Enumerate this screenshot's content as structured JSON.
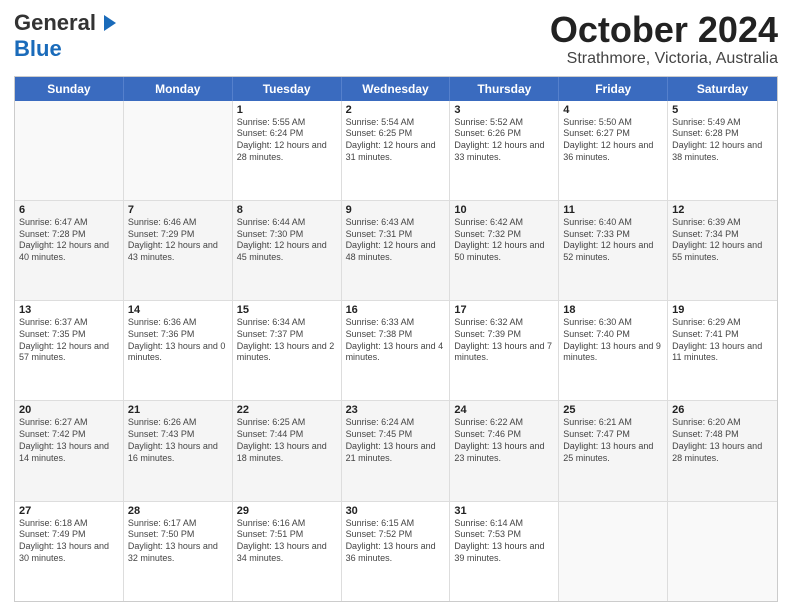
{
  "header": {
    "logo_general": "General",
    "logo_blue": "Blue",
    "title": "October 2024",
    "location": "Strathmore, Victoria, Australia"
  },
  "days_of_week": [
    "Sunday",
    "Monday",
    "Tuesday",
    "Wednesday",
    "Thursday",
    "Friday",
    "Saturday"
  ],
  "weeks": [
    [
      {
        "day": "",
        "text": ""
      },
      {
        "day": "",
        "text": ""
      },
      {
        "day": "1",
        "text": "Sunrise: 5:55 AM\nSunset: 6:24 PM\nDaylight: 12 hours and 28 minutes."
      },
      {
        "day": "2",
        "text": "Sunrise: 5:54 AM\nSunset: 6:25 PM\nDaylight: 12 hours and 31 minutes."
      },
      {
        "day": "3",
        "text": "Sunrise: 5:52 AM\nSunset: 6:26 PM\nDaylight: 12 hours and 33 minutes."
      },
      {
        "day": "4",
        "text": "Sunrise: 5:50 AM\nSunset: 6:27 PM\nDaylight: 12 hours and 36 minutes."
      },
      {
        "day": "5",
        "text": "Sunrise: 5:49 AM\nSunset: 6:28 PM\nDaylight: 12 hours and 38 minutes."
      }
    ],
    [
      {
        "day": "6",
        "text": "Sunrise: 6:47 AM\nSunset: 7:28 PM\nDaylight: 12 hours and 40 minutes."
      },
      {
        "day": "7",
        "text": "Sunrise: 6:46 AM\nSunset: 7:29 PM\nDaylight: 12 hours and 43 minutes."
      },
      {
        "day": "8",
        "text": "Sunrise: 6:44 AM\nSunset: 7:30 PM\nDaylight: 12 hours and 45 minutes."
      },
      {
        "day": "9",
        "text": "Sunrise: 6:43 AM\nSunset: 7:31 PM\nDaylight: 12 hours and 48 minutes."
      },
      {
        "day": "10",
        "text": "Sunrise: 6:42 AM\nSunset: 7:32 PM\nDaylight: 12 hours and 50 minutes."
      },
      {
        "day": "11",
        "text": "Sunrise: 6:40 AM\nSunset: 7:33 PM\nDaylight: 12 hours and 52 minutes."
      },
      {
        "day": "12",
        "text": "Sunrise: 6:39 AM\nSunset: 7:34 PM\nDaylight: 12 hours and 55 minutes."
      }
    ],
    [
      {
        "day": "13",
        "text": "Sunrise: 6:37 AM\nSunset: 7:35 PM\nDaylight: 12 hours and 57 minutes."
      },
      {
        "day": "14",
        "text": "Sunrise: 6:36 AM\nSunset: 7:36 PM\nDaylight: 13 hours and 0 minutes."
      },
      {
        "day": "15",
        "text": "Sunrise: 6:34 AM\nSunset: 7:37 PM\nDaylight: 13 hours and 2 minutes."
      },
      {
        "day": "16",
        "text": "Sunrise: 6:33 AM\nSunset: 7:38 PM\nDaylight: 13 hours and 4 minutes."
      },
      {
        "day": "17",
        "text": "Sunrise: 6:32 AM\nSunset: 7:39 PM\nDaylight: 13 hours and 7 minutes."
      },
      {
        "day": "18",
        "text": "Sunrise: 6:30 AM\nSunset: 7:40 PM\nDaylight: 13 hours and 9 minutes."
      },
      {
        "day": "19",
        "text": "Sunrise: 6:29 AM\nSunset: 7:41 PM\nDaylight: 13 hours and 11 minutes."
      }
    ],
    [
      {
        "day": "20",
        "text": "Sunrise: 6:27 AM\nSunset: 7:42 PM\nDaylight: 13 hours and 14 minutes."
      },
      {
        "day": "21",
        "text": "Sunrise: 6:26 AM\nSunset: 7:43 PM\nDaylight: 13 hours and 16 minutes."
      },
      {
        "day": "22",
        "text": "Sunrise: 6:25 AM\nSunset: 7:44 PM\nDaylight: 13 hours and 18 minutes."
      },
      {
        "day": "23",
        "text": "Sunrise: 6:24 AM\nSunset: 7:45 PM\nDaylight: 13 hours and 21 minutes."
      },
      {
        "day": "24",
        "text": "Sunrise: 6:22 AM\nSunset: 7:46 PM\nDaylight: 13 hours and 23 minutes."
      },
      {
        "day": "25",
        "text": "Sunrise: 6:21 AM\nSunset: 7:47 PM\nDaylight: 13 hours and 25 minutes."
      },
      {
        "day": "26",
        "text": "Sunrise: 6:20 AM\nSunset: 7:48 PM\nDaylight: 13 hours and 28 minutes."
      }
    ],
    [
      {
        "day": "27",
        "text": "Sunrise: 6:18 AM\nSunset: 7:49 PM\nDaylight: 13 hours and 30 minutes."
      },
      {
        "day": "28",
        "text": "Sunrise: 6:17 AM\nSunset: 7:50 PM\nDaylight: 13 hours and 32 minutes."
      },
      {
        "day": "29",
        "text": "Sunrise: 6:16 AM\nSunset: 7:51 PM\nDaylight: 13 hours and 34 minutes."
      },
      {
        "day": "30",
        "text": "Sunrise: 6:15 AM\nSunset: 7:52 PM\nDaylight: 13 hours and 36 minutes."
      },
      {
        "day": "31",
        "text": "Sunrise: 6:14 AM\nSunset: 7:53 PM\nDaylight: 13 hours and 39 minutes."
      },
      {
        "day": "",
        "text": ""
      },
      {
        "day": "",
        "text": ""
      }
    ]
  ]
}
